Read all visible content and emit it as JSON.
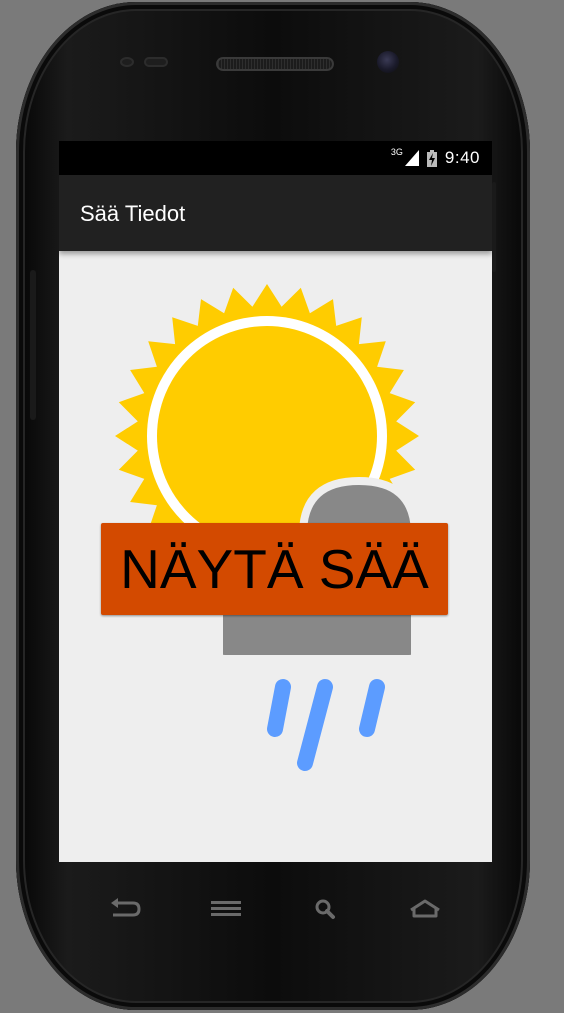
{
  "status_bar": {
    "network_label": "3G",
    "clock": "9:40",
    "icons": [
      "signal-icon",
      "battery-charging-icon"
    ]
  },
  "action_bar": {
    "title": "Sää Tiedot"
  },
  "main": {
    "button_label": "NÄYTÄ SÄÄ",
    "illustration": "sun-behind-rain-cloud"
  },
  "nav_bar": {
    "icons": [
      "back-icon",
      "menu-icon",
      "search-icon",
      "home-icon"
    ]
  },
  "colors": {
    "button_bg": "#d34a00",
    "action_bar_bg": "#212121",
    "screen_bg": "#eeeeee",
    "sun": "#ffcc00",
    "cloud": "#888888",
    "rain": "#5c9cff"
  }
}
